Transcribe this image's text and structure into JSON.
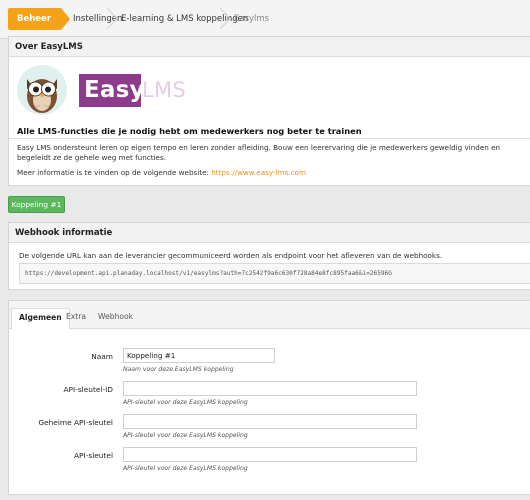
{
  "breadcrumb": {
    "items": [
      "Beheer",
      "Instellingen",
      "E-learning & LMS koppelingen",
      "Easylms"
    ]
  },
  "about": {
    "title": "Over EasyLMS",
    "logo_easy": "Easy",
    "logo_lms": "LMS",
    "tagline": "Alle LMS-functies die je nodig hebt om medewerkers nog beter te trainen",
    "description": "Easy LMS ondersteunt leren op eigen tempo en leren zonder afleiding. Bouw een leerervaring die je medewerkers geweldig vinden en begeleidt ze de gehele weg met functies.",
    "more_info_prefix": "Meer informatie is te vinden op de volgende website:",
    "more_info_link": "https://www.easy-lms.com"
  },
  "koppeling_button": "Koppeling #1",
  "webhook": {
    "title": "Webhook informatie",
    "description": "De volgende URL kan aan de leverancier gecommuniceerd worden als endpoint voor het afleveren van de webhooks.",
    "url": "https://development.api.planaday.localhost/v1/easylms?auth=7c2542f9a6c630f728a84e8fc895faa6&i=26596G"
  },
  "tabs": [
    "Algemeen",
    "Extra",
    "Webhook"
  ],
  "form": {
    "fields": [
      {
        "label": "Naam",
        "value": "Koppeling #1",
        "help": "Naam voor deze EasyLMS koppeling"
      },
      {
        "label": "API-sleutel-ID",
        "value": "",
        "help": "API-sleutel voor deze EasyLMS koppeling"
      },
      {
        "label": "Geheime API-sleutel",
        "value": "",
        "help": "API-sleutel voor deze EasyLMS koppeling"
      },
      {
        "label": "API-sleutel",
        "value": "",
        "help": "API-sleutel voor deze EasyLMS koppeling"
      }
    ]
  },
  "colors": {
    "accent": "#f5a219",
    "brand_purple": "#8c3c8b",
    "button_green": "#5cb85c",
    "link": "#e8931a"
  },
  "icons": [
    "owl-mascot-icon"
  ]
}
